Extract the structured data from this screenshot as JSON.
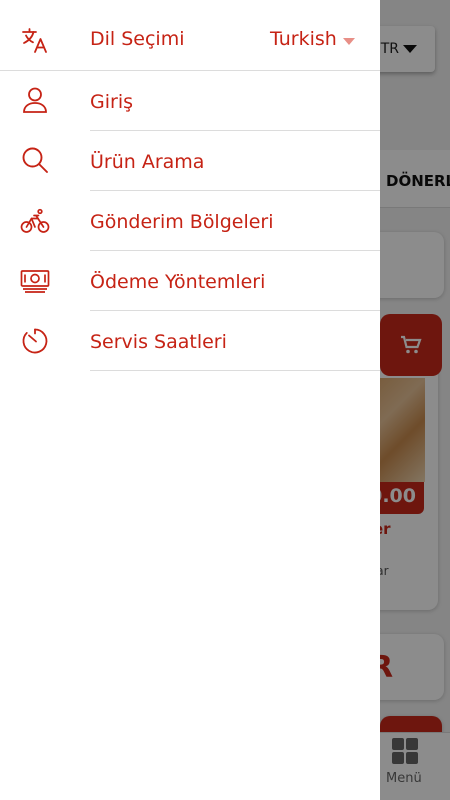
{
  "background": {
    "lang_button": "TR",
    "category_tab": "DÖNERL",
    "price": "0.00",
    "product_name": "er",
    "product_sub": "şar",
    "section_heading": "R",
    "bottom_nav_label": "Menü"
  },
  "drawer": {
    "language": {
      "label": "Dil Seçimi",
      "value": "Turkish",
      "icon": "translate-icon"
    },
    "items": [
      {
        "label": "Giriş",
        "icon": "user-icon"
      },
      {
        "label": "Ürün Arama",
        "icon": "search-icon"
      },
      {
        "label": "Gönderim Bölgeleri",
        "icon": "bicycle-icon"
      },
      {
        "label": "Ödeme Yöntemleri",
        "icon": "money-icon"
      },
      {
        "label": "Servis Saatleri",
        "icon": "timer-icon"
      }
    ]
  },
  "colors": {
    "accent": "#c62315",
    "divider": "#dcdcdc",
    "caret": "#e88f87"
  }
}
